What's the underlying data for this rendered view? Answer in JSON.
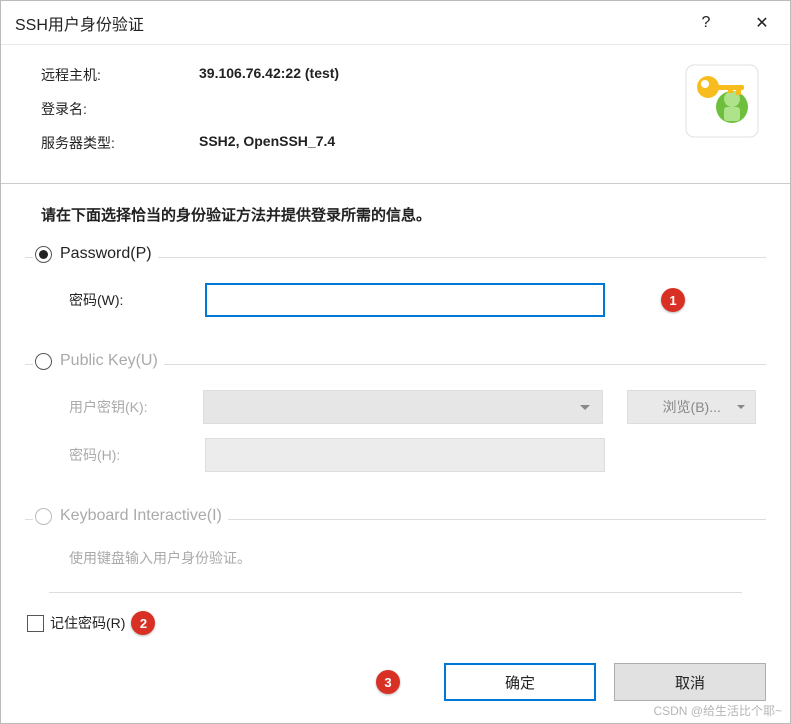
{
  "titlebar": {
    "title": "SSH用户身份验证",
    "help_label": "?",
    "close_label": "✕"
  },
  "info": {
    "host_label": "远程主机:",
    "host_value": "39.106.76.42:22 (test)",
    "login_label": "登录名:",
    "login_value": "",
    "type_label": "服务器类型:",
    "type_value": "SSH2, OpenSSH_7.4"
  },
  "instruction": "请在下面选择恰当的身份验证方法并提供登录所需的信息。",
  "password_group": {
    "label": "Password(P)",
    "field_label": "密码(W):"
  },
  "publickey_group": {
    "label": "Public Key(U)",
    "key_label": "用户密钥(K):",
    "pass_label": "密码(H):",
    "browse_label": "浏览(B)..."
  },
  "kbi_group": {
    "label": "Keyboard Interactive(I)",
    "hint": "使用键盘输入用户身份验证。"
  },
  "remember": {
    "label": "记住密码(R)"
  },
  "buttons": {
    "ok": "确定",
    "cancel": "取消"
  },
  "annotations": {
    "b1": "1",
    "b2": "2",
    "b3": "3"
  },
  "watermark": "CSDN @给生活比个耶~"
}
